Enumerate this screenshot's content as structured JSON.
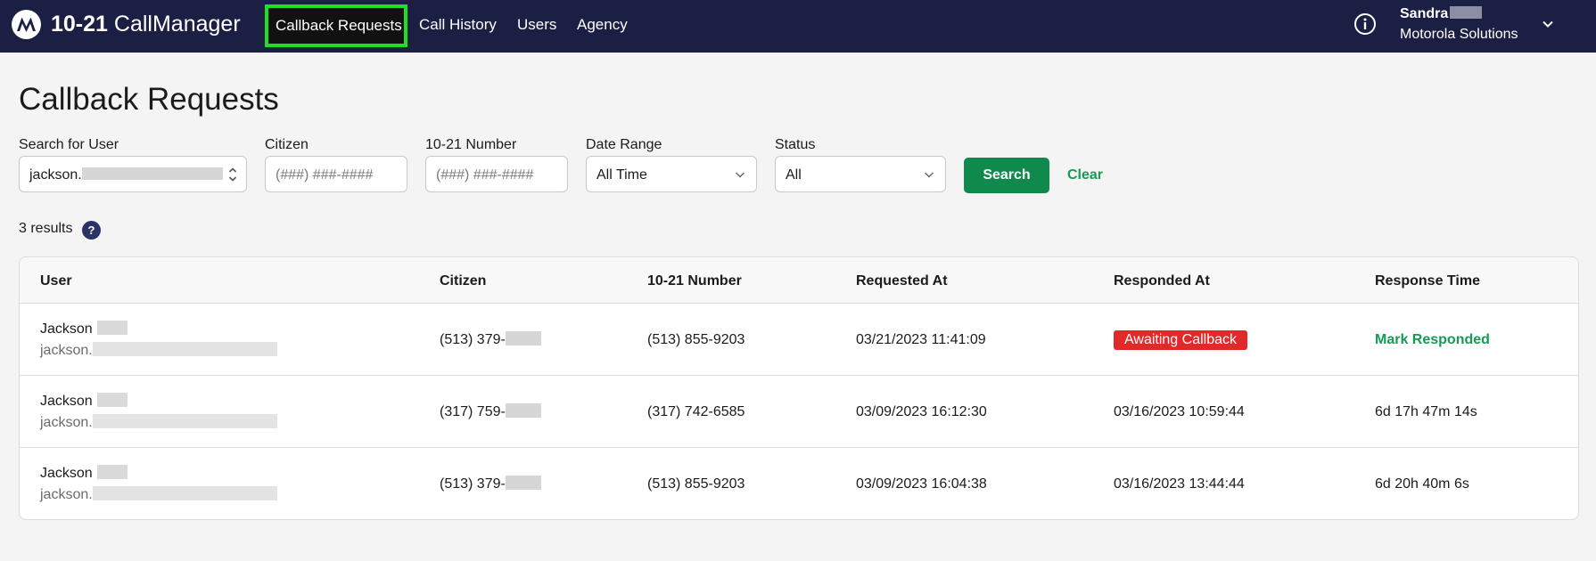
{
  "brand": {
    "prefix": "10-21",
    "suffix": "CallManager"
  },
  "nav": {
    "active": "Callback Requests",
    "items": [
      "Call History",
      "Users",
      "Agency"
    ]
  },
  "user": {
    "first_name": "Sandra",
    "org": "Motorola Solutions"
  },
  "icons": {
    "logo": "motorola-logo-icon",
    "info": "info-icon",
    "user_menu": "chevron-down-icon"
  },
  "page": {
    "title": "Callback Requests"
  },
  "filters": {
    "user": {
      "label": "Search for User",
      "value": "jackson."
    },
    "citizen": {
      "label": "Citizen",
      "placeholder": "(###) ###-####"
    },
    "number": {
      "label": "10-21 Number",
      "placeholder": "(###) ###-####"
    },
    "date_range": {
      "label": "Date Range",
      "value": "All Time"
    },
    "status": {
      "label": "Status",
      "value": "All"
    },
    "search_label": "Search",
    "clear_label": "Clear"
  },
  "results": {
    "text": "3 results",
    "help": "?"
  },
  "table": {
    "headers": [
      "User",
      "Citizen",
      "10-21 Number",
      "Requested At",
      "Responded At",
      "Response Time"
    ],
    "rows": [
      {
        "name": "Jackson",
        "email": "jackson.",
        "citizen": "(513) 379-",
        "number": "(513) 855-9203",
        "requested": "03/21/2023 11:41:09",
        "responded": "Awaiting Callback",
        "response_time": "Mark Responded"
      },
      {
        "name": "Jackson",
        "email": "jackson.",
        "citizen": "(317) 759-",
        "number": "(317) 742-6585",
        "requested": "03/09/2023 16:12:30",
        "responded": "03/16/2023 10:59:44",
        "response_time": "6d 17h 47m 14s"
      },
      {
        "name": "Jackson",
        "email": "jackson.",
        "citizen": "(513) 379-",
        "number": "(513) 855-9203",
        "requested": "03/09/2023 16:04:38",
        "responded": "03/16/2023 13:44:44",
        "response_time": "6d 20h 40m 6s"
      }
    ]
  },
  "colors": {
    "nav_bg": "#1b1f44",
    "nav_highlight": "#1ee01e",
    "primary_green": "#0f8a4c",
    "link_green": "#169a54",
    "alert_red": "#e02a2a"
  }
}
